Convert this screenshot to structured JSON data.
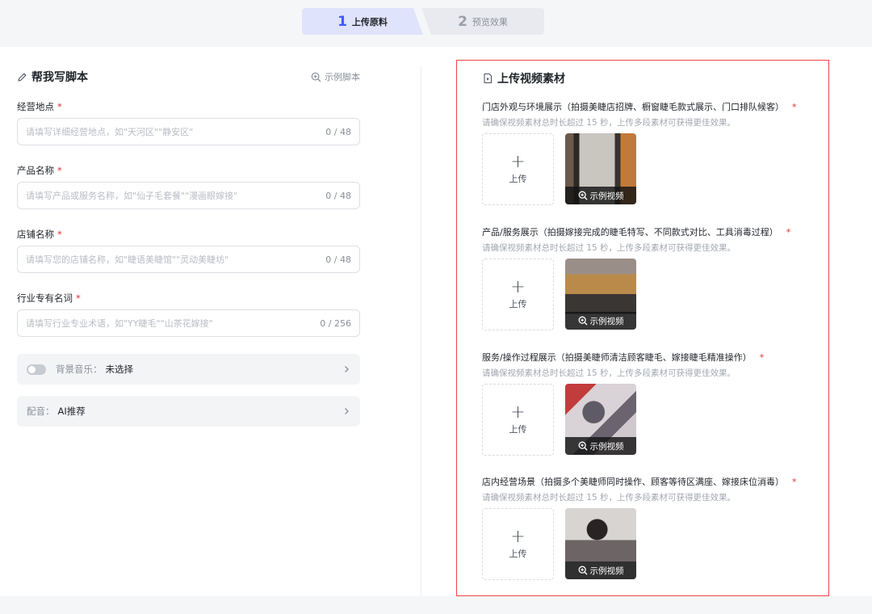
{
  "steps": [
    {
      "num": "1",
      "label": "上传原料"
    },
    {
      "num": "2",
      "label": "预览效果"
    }
  ],
  "left": {
    "title": "帮我写脚本",
    "example_link": "示例脚本",
    "fields": [
      {
        "label": "经营地点",
        "required": "*",
        "placeholder": "请填写详细经营地点，如\"天河区\"\"静安区\"",
        "value": "",
        "counter": "0 / 48"
      },
      {
        "label": "产品名称",
        "required": "*",
        "placeholder": "请填写产品或服务名称，如\"仙子毛套餐\"\"漫画眼嫁接\"",
        "value": "",
        "counter": "0 / 48"
      },
      {
        "label": "店铺名称",
        "required": "*",
        "placeholder": "请填写您的店铺名称，如\"睫语美睫馆\"\"灵动美睫坊\"",
        "value": "",
        "counter": "0 / 48"
      },
      {
        "label": "行业专有名词",
        "required": "*",
        "placeholder": "请填写行业专业术语，如\"YY睫毛\"\"山茶花嫁接\"",
        "value": "",
        "counter": "0 / 256"
      }
    ],
    "music": {
      "label": "背景音乐：",
      "value": "未选择",
      "enabled": false
    },
    "voice": {
      "label": "配音：",
      "value": "AI推荐"
    }
  },
  "right": {
    "title": "上传视频素材",
    "sections": [
      {
        "title": "门店外观与环境展示（拍摄美睫店招牌、橱窗睫毛款式展示、门口排队候客）",
        "required": "*",
        "hint": "请确保视频素材总时长超过 15 秒，上传多段素材可获得更佳效果。",
        "upload_label": "上传",
        "example_label": "示例视频"
      },
      {
        "title": "产品/服务展示（拍摄嫁接完成的睫毛特写、不同款式对比、工具消毒过程）",
        "required": "*",
        "hint": "请确保视频素材总时长超过 15 秒，上传多段素材可获得更佳效果。",
        "upload_label": "上传",
        "example_label": "示例视频"
      },
      {
        "title": "服务/操作过程展示（拍摄美睫师清洁顾客睫毛、嫁接睫毛精准操作）",
        "required": "*",
        "hint": "请确保视频素材总时长超过 15 秒，上传多段素材可获得更佳效果。",
        "upload_label": "上传",
        "example_label": "示例视频"
      },
      {
        "title": "店内经营场景（拍摄多个美睫师同时操作、顾客等待区满座、嫁接床位消毒）",
        "required": "*",
        "hint": "请确保视频素材总时长超过 15 秒，上传多段素材可获得更佳效果。",
        "upload_label": "上传",
        "example_label": "示例视频"
      }
    ]
  },
  "colors": {
    "accent": "#3d5afe",
    "required": "#e03131",
    "highlight_border": "#ef4444"
  },
  "icons": {
    "left_title": "pencil-icon",
    "example_link": "zoom-in-icon",
    "right_title": "video-file-icon",
    "upload": "plus-icon",
    "row_arrow": "chevron-right-icon"
  }
}
